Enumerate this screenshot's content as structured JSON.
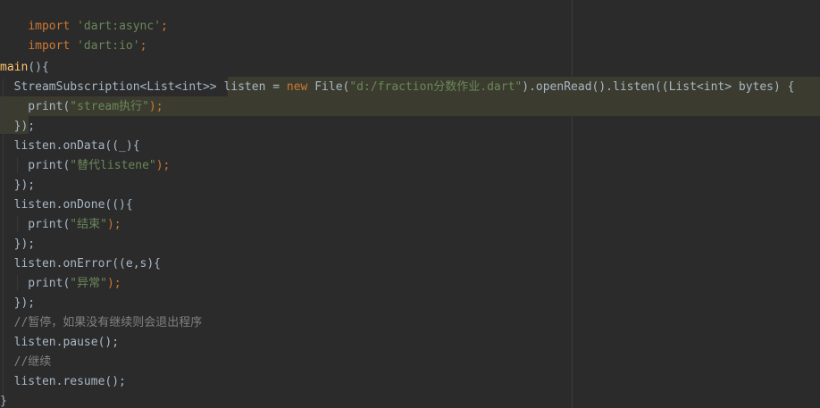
{
  "colors": {
    "background": "#2b2b2b",
    "keyword": "#cc7832",
    "string": "#6a8759",
    "method": "#ffc66d",
    "comment": "#808080",
    "text": "#a9b7c6",
    "highlight": "#3b3c2f"
  },
  "code": {
    "line1": {
      "kw": "import",
      "str": "'dart:async'",
      "end": ";"
    },
    "line2": {
      "kw": "import",
      "str": "'dart:io'",
      "end": ";"
    },
    "line4": {
      "fn": "main",
      "rest": "(){"
    },
    "line5": {
      "a": "  StreamSubscription<List<int>> listen = ",
      "kw": "new",
      "b": " File(",
      "str": "\"d:/fraction分数作业.dart\"",
      "c": ").openRead().listen((List<int> bytes) {"
    },
    "line6": {
      "a": "    print(",
      "str": "\"stream执行\"",
      "b": ");"
    },
    "line7": {
      "text": "  });"
    },
    "line8": {
      "text": "  listen.onData((_){"
    },
    "line9": {
      "a": "    print(",
      "str": "\"替代listene\"",
      "b": ");"
    },
    "line10": {
      "text": "  });"
    },
    "line11": {
      "text": "  listen.onDone((){"
    },
    "line12": {
      "a": "    print(",
      "str": "\"结束\"",
      "b": ");"
    },
    "line13": {
      "text": "  });"
    },
    "line14": {
      "text": "  listen.onError((e,s){"
    },
    "line15": {
      "a": "    print(",
      "str": "\"异常\"",
      "b": ");"
    },
    "line16": {
      "text": "  });"
    },
    "line17": {
      "cm": "  //暂停，如果没有继续则会退出程序"
    },
    "line18": {
      "text": "  listen.pause();"
    },
    "line19": {
      "cm": "  //继续"
    },
    "line20": {
      "text": "  listen.resume();"
    },
    "line21": {
      "text": "}"
    }
  }
}
